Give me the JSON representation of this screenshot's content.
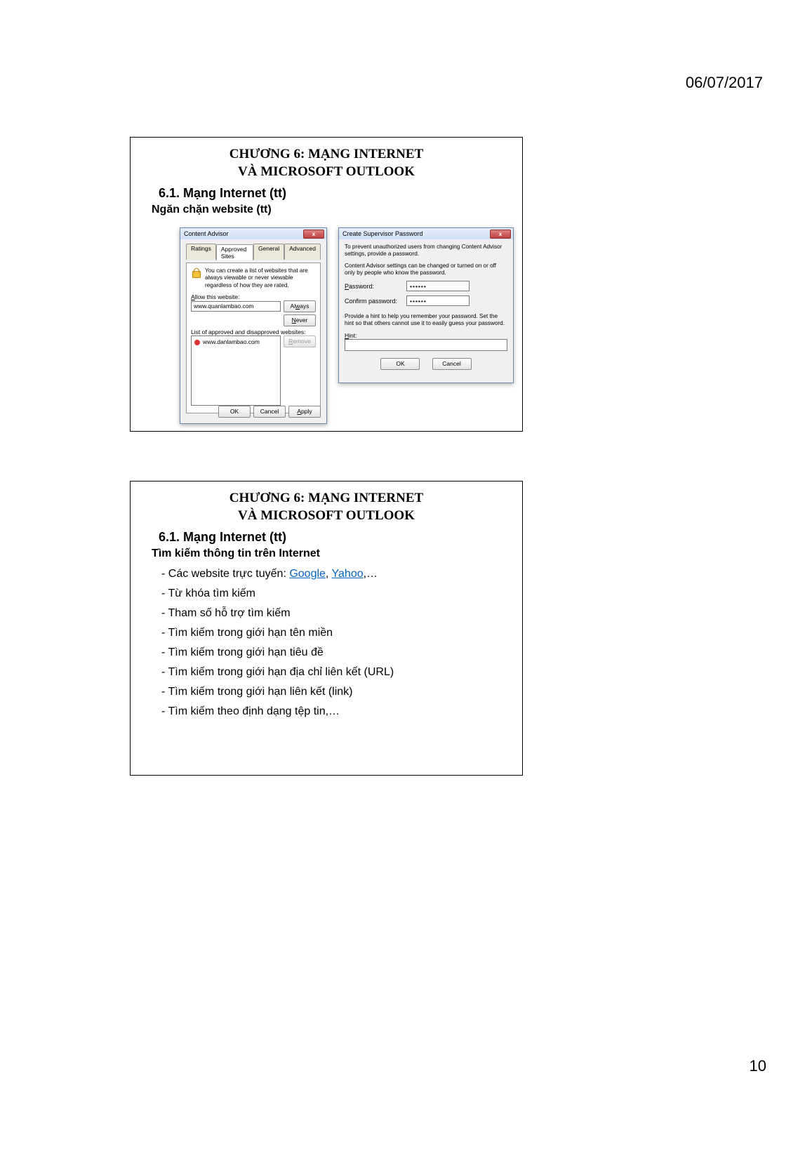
{
  "page": {
    "date": "06/07/2017",
    "number": "10"
  },
  "slide1": {
    "title_line1": "CHƯƠNG 6: MẠNG INTERNET",
    "title_line2": "VÀ MICROSOFT OUTLOOK",
    "section": "6.1. Mạng Internet (tt)",
    "subsection": "Ngăn chặn website (tt)",
    "dialog1": {
      "title": "Content Advisor",
      "close": "x",
      "tabs": [
        "Ratings",
        "Approved Sites",
        "General",
        "Advanced"
      ],
      "active_tab_index": 1,
      "description": "You can create a list of websites that are always viewable or never viewable regardless of how they are rated.",
      "allow_label": "Allow this website:",
      "allow_value": "www.quanlambao.com",
      "list_label": "List of approved and disapproved websites:",
      "disapproved_item": "www.danlambao.com",
      "buttons": {
        "always": "Always",
        "never": "Never",
        "remove": "Remove",
        "ok": "OK",
        "cancel": "Cancel",
        "apply": "Apply"
      }
    },
    "dialog2": {
      "title": "Create Supervisor Password",
      "close": "x",
      "text1": "To prevent unauthorized users from changing Content Advisor settings, provide a password.",
      "text2": "Content Advisor settings can be changed or turned on or off only by people who know the password.",
      "password_label": "Password:",
      "password_value": "••••••",
      "confirm_label": "Confirm password:",
      "confirm_value": "••••••",
      "hint_text": "Provide a hint to help you remember your password. Set the hint so that others cannot use it to easily guess your password.",
      "hint_label": "Hint:",
      "ok": "OK",
      "cancel": "Cancel"
    }
  },
  "slide2": {
    "title_line1": "CHƯƠNG 6: MẠNG INTERNET",
    "title_line2": "VÀ MICROSOFT OUTLOOK",
    "section": "6.1. Mạng Internet (tt)",
    "subsection": "Tìm kiếm thông tin trên Internet",
    "bullet1_prefix": "- Các website trực tuyến:  ",
    "bullet1_link1": "Google",
    "bullet1_sep": ", ",
    "bullet1_link2": "Yahoo",
    "bullet1_suffix": ",…",
    "bullets": [
      "- Từ khóa tìm kiếm",
      "- Tham số hỗ trợ tìm kiếm",
      "- Tìm kiếm trong giới hạn tên miền",
      "- Tìm kiếm trong giới hạn tiêu đề",
      "- Tìm kiếm trong giới hạn địa chỉ liên kết (URL)",
      "- Tìm kiếm trong giới hạn liên kết (link)",
      "- Tìm kiếm theo định dạng tệp tin,…"
    ]
  }
}
